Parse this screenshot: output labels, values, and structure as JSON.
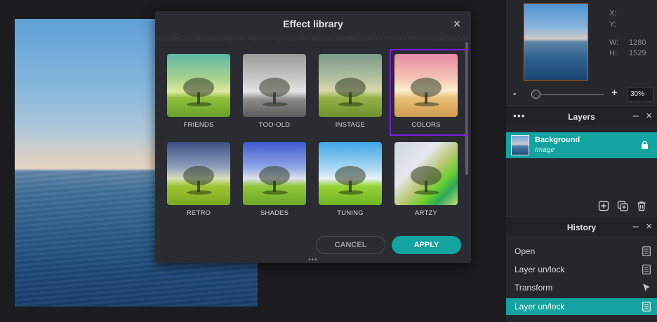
{
  "dialog": {
    "title": "Effect library",
    "close_glyph": "×",
    "effects": [
      {
        "label": "FRIENDS",
        "selected": false
      },
      {
        "label": "TOO-OLD",
        "selected": false
      },
      {
        "label": "INSTAGE",
        "selected": false
      },
      {
        "label": "COLORS",
        "selected": true
      },
      {
        "label": "RETRO",
        "selected": false
      },
      {
        "label": "SHADES",
        "selected": false
      },
      {
        "label": "TUNING",
        "selected": false
      },
      {
        "label": "ARTZY",
        "selected": false
      }
    ],
    "cancel_label": "CANCEL",
    "apply_label": "APPLY",
    "grip_glyph": "•••"
  },
  "navigator": {
    "x_label": "X:",
    "y_label": "Y:",
    "w_label": "W:",
    "w_value": "1280",
    "h_label": "H:",
    "h_value": "1529",
    "zoom_minus": "-",
    "zoom_plus": "+",
    "zoom_value": "30%",
    "zoom_level_fraction": 0.1
  },
  "layers": {
    "title": "Layers",
    "dots": "•••",
    "minimize": "–",
    "close": "×",
    "items": [
      {
        "name": "Background",
        "type": "Image",
        "locked": true
      }
    ]
  },
  "history": {
    "title": "History",
    "minimize": "–",
    "close": "×",
    "items": [
      {
        "label": "Open",
        "icon": "document-icon",
        "active": false
      },
      {
        "label": "Layer un/lock",
        "icon": "document-icon",
        "active": false
      },
      {
        "label": "Transform",
        "icon": "cursor-icon",
        "active": false
      },
      {
        "label": "Layer un/lock",
        "icon": "document-icon",
        "active": true
      }
    ]
  },
  "colors": {
    "accent": "#13a3a0",
    "selection": "#7a1fe0",
    "panel": "#25272b",
    "dialog": "#2a2c31"
  }
}
